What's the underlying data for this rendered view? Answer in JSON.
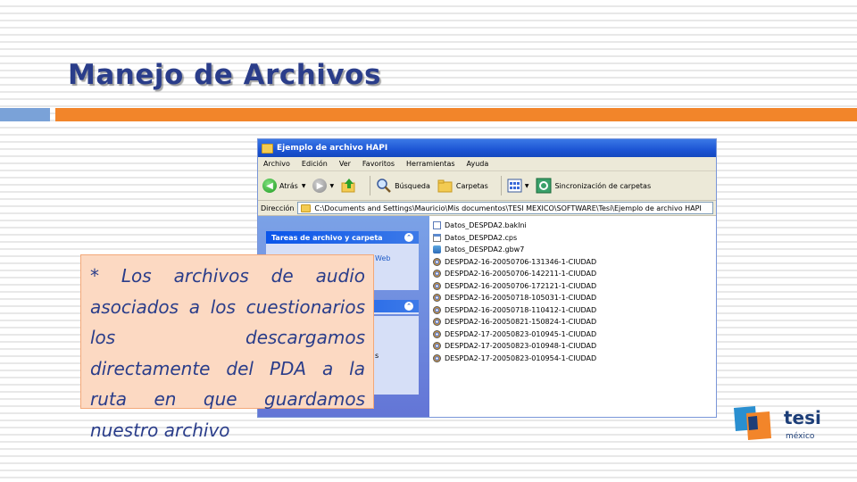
{
  "slide": {
    "title": "Manejo de Archivos",
    "accent_colors": {
      "blue": "#7aa2d8",
      "orange": "#f2852a",
      "title": "#2a3d8a"
    }
  },
  "window": {
    "title": "Ejemplo de archivo HAPI",
    "menu": [
      "Archivo",
      "Edición",
      "Ver",
      "Favoritos",
      "Herramientas",
      "Ayuda"
    ],
    "toolbar": {
      "back_label": "Atrás",
      "search_label": "Búsqueda",
      "folders_label": "Carpetas",
      "sync_label": "Sincronización de carpetas"
    },
    "address": {
      "label": "Dirección",
      "path": "C:\\Documents and Settings\\Mauricio\\Mis documentos\\TESI MEXICO\\SOFTWARE\\Tesi\\Ejemplo de archivo HAPI"
    },
    "left_pane": {
      "panel1_title": "Tareas de archivo y carpeta",
      "panel1_partial_item": "Web",
      "panel3_partial_item": "s"
    },
    "files": [
      {
        "name": "Datos_DESPDA2.bakIni",
        "icon": "doc"
      },
      {
        "name": "Datos_DESPDA2.cps",
        "icon": "cps"
      },
      {
        "name": "Datos_DESPDA2.gbw7",
        "icon": "gbw"
      },
      {
        "name": "DESPDA2-16-20050706-131346-1-CIUDAD",
        "icon": "media"
      },
      {
        "name": "DESPDA2-16-20050706-142211-1-CIUDAD",
        "icon": "media"
      },
      {
        "name": "DESPDA2-16-20050706-172121-1-CIUDAD",
        "icon": "media"
      },
      {
        "name": "DESPDA2-16-20050718-105031-1-CIUDAD",
        "icon": "media"
      },
      {
        "name": "DESPDA2-16-20050718-110412-1-CIUDAD",
        "icon": "media"
      },
      {
        "name": "DESPDA2-16-20050821-150824-1-CIUDAD",
        "icon": "media"
      },
      {
        "name": "DESPDA2-17-20050823-010945-1-CIUDAD",
        "icon": "media"
      },
      {
        "name": "DESPDA2-17-20050823-010948-1-CIUDAD",
        "icon": "media"
      },
      {
        "name": "DESPDA2-17-20050823-010954-1-CIUDAD",
        "icon": "media"
      }
    ]
  },
  "callout": {
    "text": "* Los archivos de audio asociados a los cuestionarios los descargamos directamente del PDA a la ruta en que guardamos nuestro archivo"
  },
  "logo": {
    "word": "tesi",
    "sub": "méxico",
    "colors": {
      "orange": "#f2852a",
      "blue": "#2a8fd0",
      "navy": "#1d3e78"
    }
  }
}
